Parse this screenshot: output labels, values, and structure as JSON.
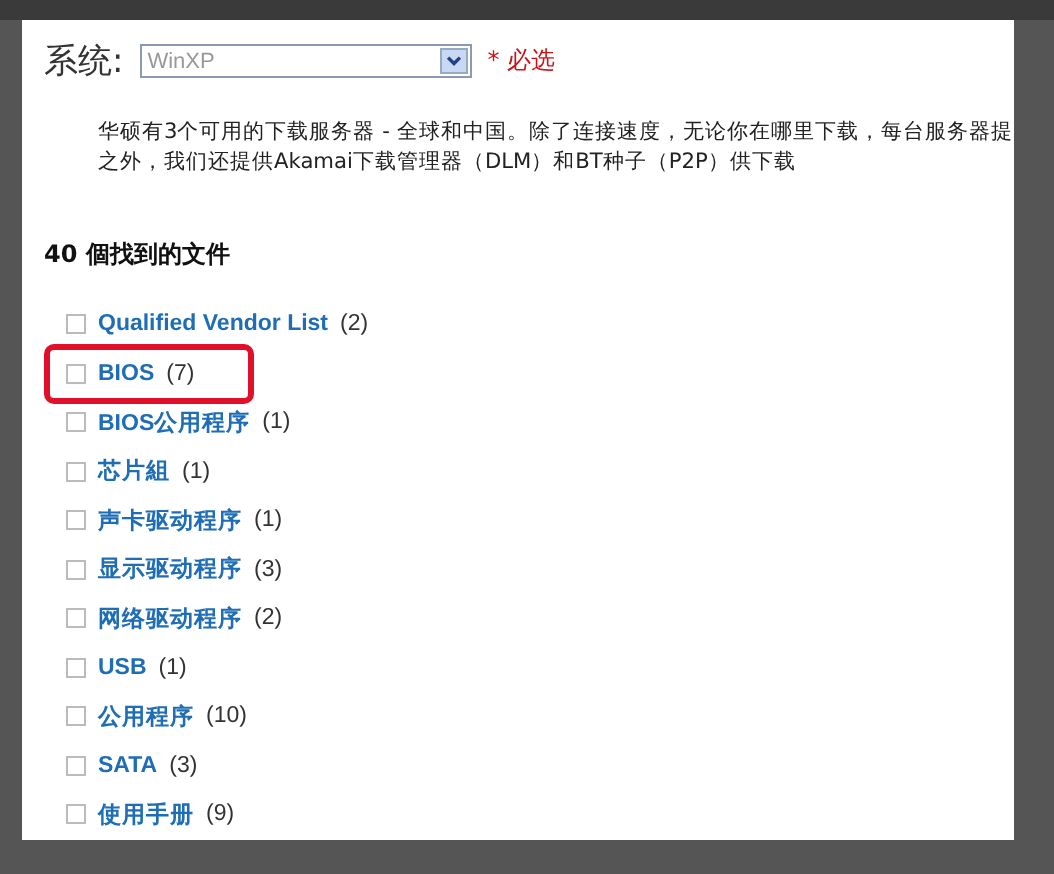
{
  "system": {
    "label": "系统:",
    "value": "WinXP",
    "required": "* 必选"
  },
  "description": [
    "华硕有3个可用的下载服务器 - 全球和中国。除了连接速度，无论你在哪里下载，每台服务器提",
    "之外，我们还提供Akamai下载管理器（DLM）和BT种子（P2P）供下载"
  ],
  "results_title": "40 個找到的文件",
  "categories": [
    {
      "name": "Qualified Vendor List",
      "count": "(2)",
      "checked": false,
      "highlighted": false
    },
    {
      "name": "BIOS",
      "count": "(7)",
      "checked": false,
      "highlighted": true
    },
    {
      "name": "BIOS公用程序",
      "count": "(1)",
      "checked": false,
      "highlighted": false
    },
    {
      "name": "芯片組",
      "count": "(1)",
      "checked": false,
      "highlighted": false
    },
    {
      "name": "声卡驱动程序",
      "count": "(1)",
      "checked": false,
      "highlighted": false
    },
    {
      "name": "显示驱动程序",
      "count": "(3)",
      "checked": false,
      "highlighted": false
    },
    {
      "name": "网络驱动程序",
      "count": "(2)",
      "checked": false,
      "highlighted": false
    },
    {
      "name": "USB",
      "count": "(1)",
      "checked": false,
      "highlighted": false
    },
    {
      "name": "公用程序",
      "count": "(10)",
      "checked": false,
      "highlighted": false
    },
    {
      "name": "SATA",
      "count": "(3)",
      "checked": false,
      "highlighted": false
    },
    {
      "name": "使用手册",
      "count": "(9)",
      "checked": false,
      "highlighted": false
    }
  ]
}
